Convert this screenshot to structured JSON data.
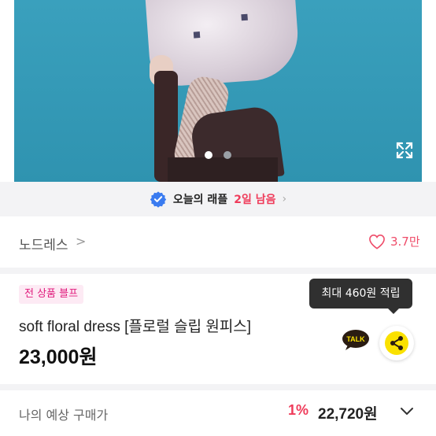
{
  "gallery": {
    "total_images": 2,
    "active_index": 0
  },
  "raffle": {
    "label": "오늘의 래플",
    "remaining": "2일 남음",
    "chevron": "›"
  },
  "shop": {
    "name": "노드레스",
    "chevron": ">",
    "likes": "3.7만"
  },
  "product": {
    "badge": "전 상품 블프",
    "title": "soft floral dress [플로럴 슬립 원피스]",
    "price": "23,000원"
  },
  "reward_tooltip": "최대 460원 적립",
  "talk_label": "TALK",
  "estimate": {
    "label": "나의 예상 구매가",
    "discount": "1%",
    "price": "22,720원"
  },
  "colors": {
    "accent_red": "#ef3b5a",
    "pink_badge": "#e0197b",
    "kakao_yellow": "#fae100",
    "verified_blue": "#3a7bf0"
  }
}
